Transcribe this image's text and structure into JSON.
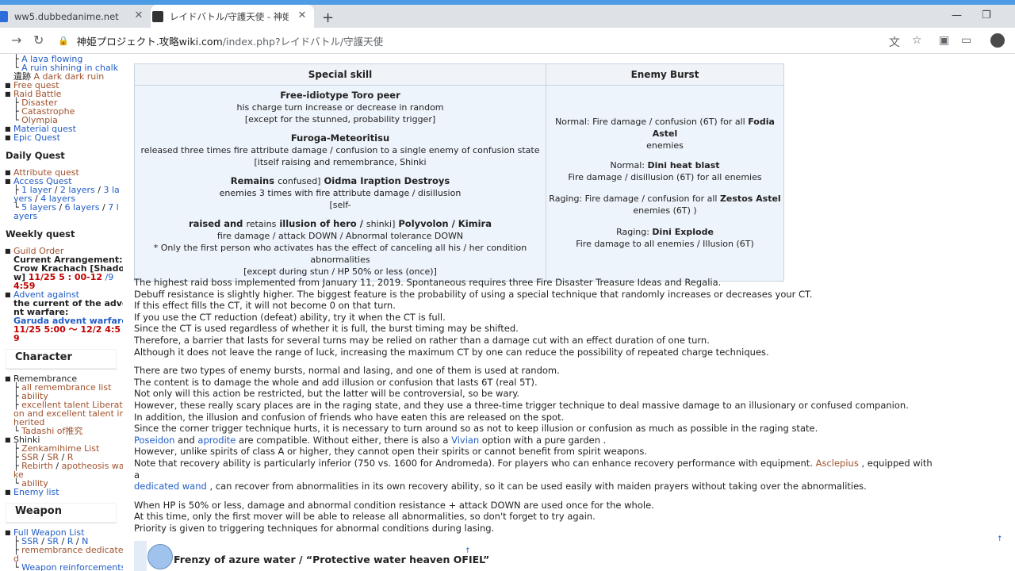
{
  "browser": {
    "tab1_title": "ww5.dubbedanime.net",
    "tab2_title": "レイドバトル/守護天使 - 神姫プロジェ",
    "url_host": "神姫プロジェクト.攻略wiki.com",
    "url_path": "/index.php?レイドバトル/守護天使"
  },
  "sidebar": {
    "lava": "A lava flowing",
    "ruin": "A ruin shining in chalk",
    "iseki_prefix": "遺跡",
    "iseki_link": "A dark dark ruin",
    "free_quest": "Free quest",
    "raid_battle": "Raid Battle",
    "disaster": "Disaster",
    "catastrophe": "Catastrophe",
    "olympia": "Olympia",
    "material_quest": "Material quest",
    "epic_quest": "Epic Quest",
    "daily_heading": "Daily Quest",
    "attribute_quest": "Attribute quest",
    "access_quest": "Access Quest",
    "layer1": "1 layer",
    "layer2": "2 layers",
    "layer3a": "3 la",
    "layer3b": "yers",
    "layer4": "4 layers",
    "layer5": "5 layers",
    "layer6": "6 layers",
    "layer7a": "7 l",
    "layer7b": "ayers",
    "weekly_heading": "Weekly quest",
    "guild_order": "Guild Order",
    "current_arr": "Current Arrangement:",
    "crow_a": "Crow Krachach [Shado",
    "crow_b": "w]",
    "crow_date_a": "11/25 5 : 00-12",
    "crow_date_b": "/9",
    "crow_date_c": "4:59",
    "advent_against": "Advent against",
    "advent_cur_a": "the current of the adve",
    "advent_cur_b": "nt warfare:",
    "garuda": "Garuda advent warfare",
    "garuda_date_a": "11/25 5:00 ～ 12/2 4:5",
    "garuda_date_b": "9",
    "character_heading": "Character",
    "remembrance": "Remembrance",
    "all_remembrance": "all remembrance list",
    "ability": "ability",
    "excellent_a": "excellent talent Liberati",
    "excellent_b": "on and excellent talent in",
    "excellent_c": "herited",
    "tadashi": "Tadashi of推究",
    "shinki": "Shinki",
    "zenkamihime": "Zenkamihime List",
    "ssr": "SSR",
    "sr": "SR",
    "r": "R",
    "rebirth": "Rebirth",
    "apotheosis_a": "apotheosis wa",
    "apotheosis_b": "ke",
    "ability2": "ability",
    "enemy_list": "Enemy list",
    "weapon_heading": "Weapon",
    "full_weapon": "Full Weapon List",
    "n": "N",
    "remembrance_ded_a": "remembrance dedicate",
    "remembrance_ded_b": "d",
    "weapon_reinf": "Weapon reinforcements"
  },
  "table": {
    "special_header": "Special skill",
    "burst_header": "Enemy Burst",
    "s1_name": "Free-idiotype Toro peer",
    "s1_l1": "his charge turn increase or decrease in random",
    "s1_l2": "[except for the stunned, probability trigger]",
    "s2_name": "Furoga-Meteoritisu",
    "s2_l1": "released three times fire attribute damage / confusion to a single enemy of confusion state",
    "s2_l2": "[itself raising and remembrance, Shinki",
    "s3_a": "Remains",
    "s3_b": "confused]",
    "s3_c": "Oidma Iraption Destroys",
    "s3_l1": "enemies 3 times with fire attribute damage / disillusion",
    "s3_l2": "[self-",
    "s4_a": "raised and",
    "s4_b": "retains",
    "s4_c": "illusion of hero /",
    "s4_d": "shinki]",
    "s4_e": "Polyvolon / Kimira",
    "s4_l1": "fire damage / attack DOWN / Abnormal tolerance DOWN",
    "s4_l2": "* Only the first person who activates has the effect of canceling all his / her condition abnormalities",
    "s4_l3": "[except during stun / HP 50% or less (once)]",
    "b1_a": "Normal: Fire damage / confusion (6T) for all",
    "b1_b": "Fodia Astel",
    "b1_c": "enemies",
    "b2_a": "Normal:",
    "b2_b": "Dini heat blast",
    "b2_c": "Fire damage / disillusion (6T) for all enemies",
    "b3_a": "Raging: Fire damage / confusion for all",
    "b3_b": "Zestos Astel",
    "b3_c": "enemies (6T) )",
    "b4_a": "Raging:",
    "b4_b": "Dini Explode",
    "b4_c": "Fire damage to all enemies / Illusion (6T)"
  },
  "body": {
    "p1_l1": "The highest raid boss implemented from January 11, 2019. Spontaneous requires three Fire Disaster Treasure Ideas and Regalia.",
    "p1_l2": "Debuff resistance is slightly higher. The biggest feature is the probability of using a special technique that randomly increases or decreases your CT.",
    "p1_l3": "If this effect fills the CT, it will not become 0 on that turn.",
    "p1_l4": "If you use the CT reduction (defeat) ability, try it when the CT is full.",
    "p1_l5": "Since the CT is used regardless of whether it is full, the burst timing may be shifted.",
    "p1_l6": "Therefore, a barrier that lasts for several turns may be relied on rather than a damage cut with an effect duration of one turn.",
    "p1_l7": "Although it does not leave the range of luck, increasing the maximum CT by one can reduce the possibility of repeated charge techniques.",
    "p2_l1": "There are two types of enemy bursts, normal and lasing, and one of them is used at random.",
    "p2_l2": "The content is to damage the whole and add illusion or confusion that lasts 6T (real 5T).",
    "p2_l3": "Not only will this action be restricted, but the latter will be controversial, so be wary.",
    "p2_l4": "However, these really scary places are in the raging state, and they use a three-time trigger technique to deal massive damage to an illusionary or confused companion.",
    "p2_l5": "In addition, the illusion and confusion of friends who have eaten this are released on the spot.",
    "p2_l6": "Since the corner trigger technique hurts, it is necessary to turn around so as not to keep illusion or confusion as much as possible in the raging state.",
    "poseidon": "Poseidon",
    "and": "and",
    "aprodite": "aprodite",
    "p2_l7b": "are compatible. Without either, there is also a",
    "vivian": "Vivian",
    "p2_l7c": "option with a pure garden .",
    "p2_l8": "However, unlike spirits of class A or higher, they cannot open their spirits or cannot benefit from spirit weapons.",
    "p2_l9a": "Note that recovery ability is particularly inferior (750 vs. 1600 for Andromeda). For players who can enhance recovery performance with equipment.",
    "asclepius": "Asclepius",
    "p2_l9b": ", equipped with a",
    "wand": "dedicated wand",
    "p2_l10": ", can recover from abnormalities in its own recovery ability, so it can be used easily with maiden prayers without taking over the abnormalities.",
    "p3_l1": "When HP is 50% or less, damage and abnormal condition resistance + attack DOWN are used once for the whole.",
    "p3_l2": "At this time, only the first mover will be able to release all abnormalities, so don't forget to try again.",
    "p3_l3": "Priority is given to triggering techniques for abnormal conditions during lasing.",
    "frenzy_title": "Frenzy of azure water / “Protective water heaven OFIEL”",
    "up_arrow": "↑"
  }
}
